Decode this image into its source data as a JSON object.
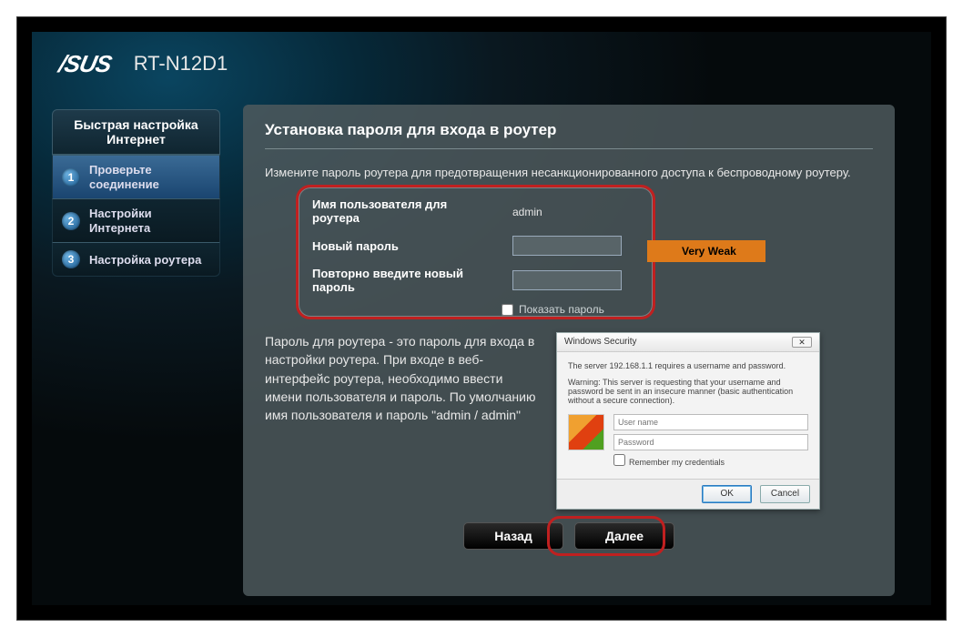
{
  "brand": "/SUS",
  "model": "RT-N12D1",
  "sidebar": {
    "header": "Быстрая настройка Интернет",
    "steps": [
      {
        "num": "1",
        "label": "Проверьте соединение"
      },
      {
        "num": "2",
        "label": "Настройки Интернета"
      },
      {
        "num": "3",
        "label": "Настройка роутера"
      }
    ]
  },
  "page": {
    "title": "Установка пароля для входа в роутер",
    "description": "Измените пароль роутера для предотвращения несанкционированного доступа к беспроводному роутеру.",
    "form": {
      "username_label": "Имя пользователя для роутера",
      "username_value": "admin",
      "newpw_label": "Новый пароль",
      "confirmpw_label": "Повторно введите новый пароль",
      "showpw_label": "Показать пароль"
    },
    "strength": "Very Weak",
    "help": "Пароль для роутера - это пароль для входа в настройки роутера. При входе в веб-интерфейс роутера, необходимо ввести имени пользователя и пароль. По умолчанию имя пользователя и пароль \"admin / admin\"",
    "winbox": {
      "title": "Windows Security",
      "line1": "The server 192.168.1.1  requires a username and password.",
      "line2": "Warning: This server is requesting that your username and password be sent in an insecure manner (basic authentication without a secure connection).",
      "user_ph": "User name",
      "pass_ph": "Password",
      "remember": "Remember my credentials",
      "ok": "OK",
      "cancel": "Cancel"
    },
    "back": "Назад",
    "next": "Далее"
  }
}
